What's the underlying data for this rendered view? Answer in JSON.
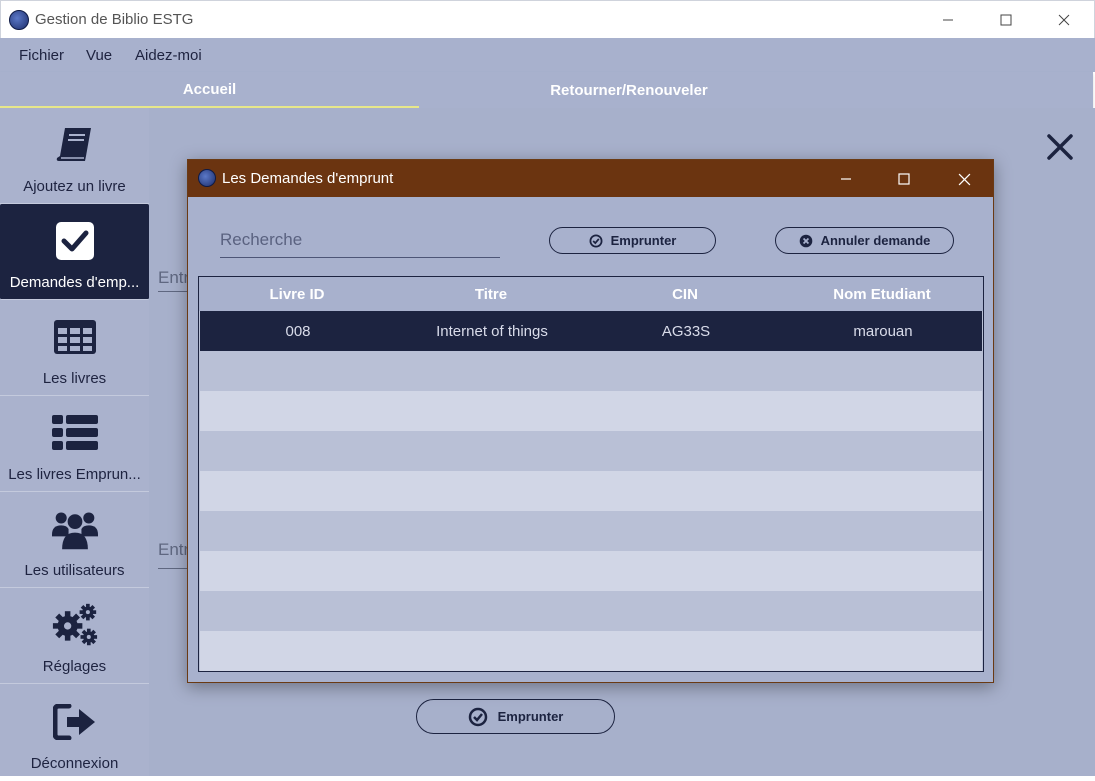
{
  "window": {
    "title": "Gestion de Biblio ESTG",
    "minimize": "—",
    "maximize": "☐",
    "close": "✕"
  },
  "menu": {
    "items": [
      "Fichier",
      "Vue",
      "Aidez-moi"
    ]
  },
  "tabs": [
    {
      "label": "Accueil",
      "active": true
    },
    {
      "label": "Retourner/Renouveler",
      "active": false
    }
  ],
  "sidebar": {
    "items": [
      {
        "label": "Ajoutez un livre",
        "icon": "book-icon"
      },
      {
        "label": "Demandes d'emp...",
        "icon": "checkbox-icon",
        "active": true
      },
      {
        "label": "Les livres",
        "icon": "table-icon"
      },
      {
        "label": "Les livres Emprun...",
        "icon": "list-icon"
      },
      {
        "label": "Les utilisateurs",
        "icon": "users-icon"
      },
      {
        "label": "Réglages",
        "icon": "gears-icon"
      },
      {
        "label": "Déconnexion",
        "icon": "logout-icon"
      }
    ]
  },
  "main": {
    "entry_fields": [
      "Entr",
      "Entr"
    ],
    "emprunter_label": "Emprunter"
  },
  "dialog": {
    "title": "Les Demandes d'emprunt",
    "minimize": "—",
    "maximize": "☐",
    "close": "✕",
    "search_placeholder": "Recherche",
    "emprunter_label": "Emprunter",
    "annuler_label": "Annuler demande",
    "table": {
      "columns": [
        "Livre ID",
        "Titre",
        "CIN",
        "Nom Etudiant"
      ],
      "rows": [
        [
          "008",
          "Internet of things",
          "AG33S",
          "marouan"
        ]
      ]
    }
  },
  "colors": {
    "accent_dark": "#1c2340",
    "dialog_title": "#6b3410",
    "background": "#a8b1cd"
  }
}
